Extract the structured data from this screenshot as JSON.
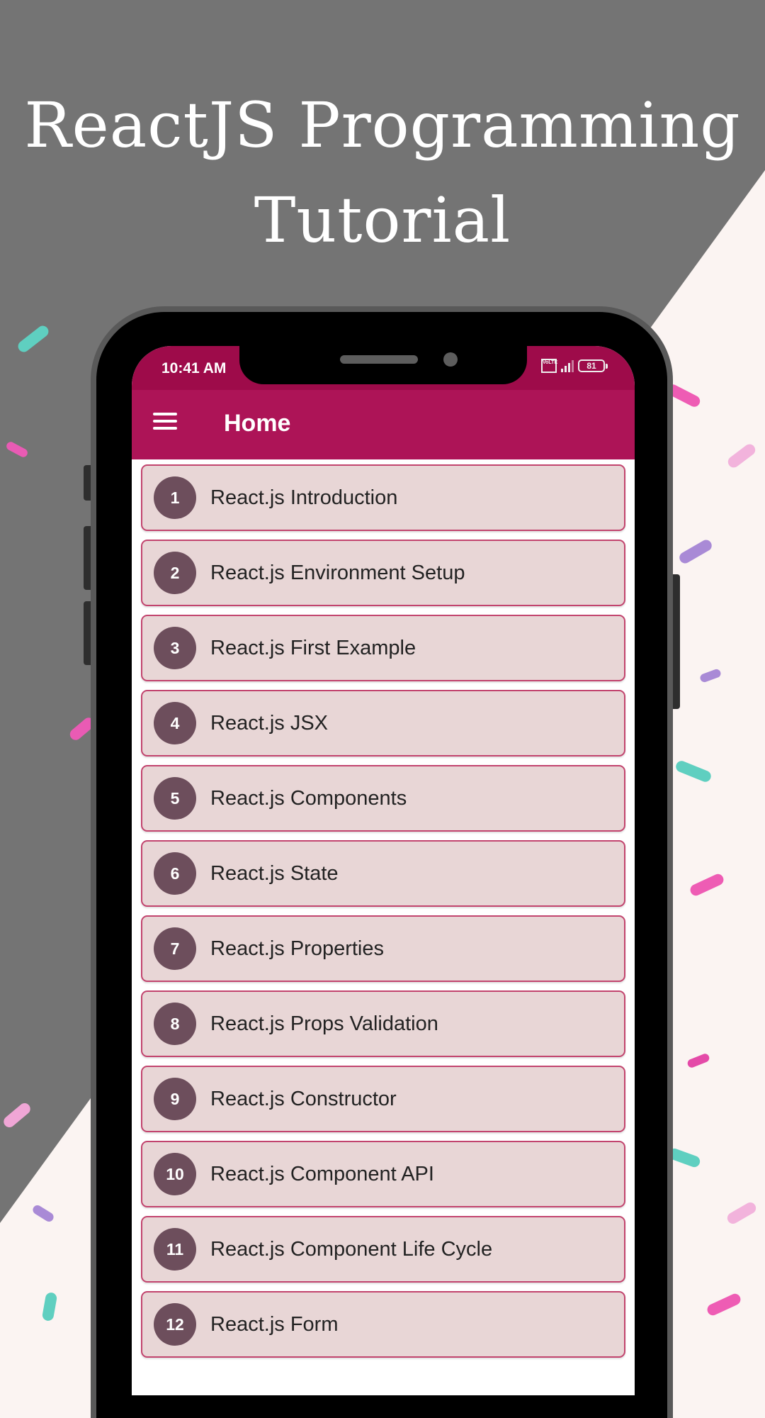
{
  "hero": {
    "line1": "ReactJS Programming",
    "line2": "Tutorial"
  },
  "colors": {
    "app_bar": "#ad1457",
    "status_bar": "#9e0b4a",
    "card_bg": "#e8d6d6",
    "card_border": "#c2446e",
    "badge_bg": "#6d4e5c",
    "bg_dark": "#747474",
    "bg_light": "#fbf4f2"
  },
  "status_bar": {
    "time": "10:41 AM",
    "network_badge": "VoLTE",
    "battery": "81"
  },
  "app_bar": {
    "menu_icon": "hamburger-menu-icon",
    "title": "Home"
  },
  "topics": [
    {
      "number": "1",
      "title": "React.js Introduction"
    },
    {
      "number": "2",
      "title": "React.js Environment Setup"
    },
    {
      "number": "3",
      "title": "React.js First Example"
    },
    {
      "number": "4",
      "title": "React.js JSX"
    },
    {
      "number": "5",
      "title": "React.js Components"
    },
    {
      "number": "6",
      "title": "React.js State"
    },
    {
      "number": "7",
      "title": "React.js Properties"
    },
    {
      "number": "8",
      "title": "React.js Props Validation"
    },
    {
      "number": "9",
      "title": "React.js Constructor"
    },
    {
      "number": "10",
      "title": "React.js Component API"
    },
    {
      "number": "11",
      "title": "React.js Component Life Cycle"
    },
    {
      "number": "12",
      "title": "React.js Form"
    }
  ]
}
